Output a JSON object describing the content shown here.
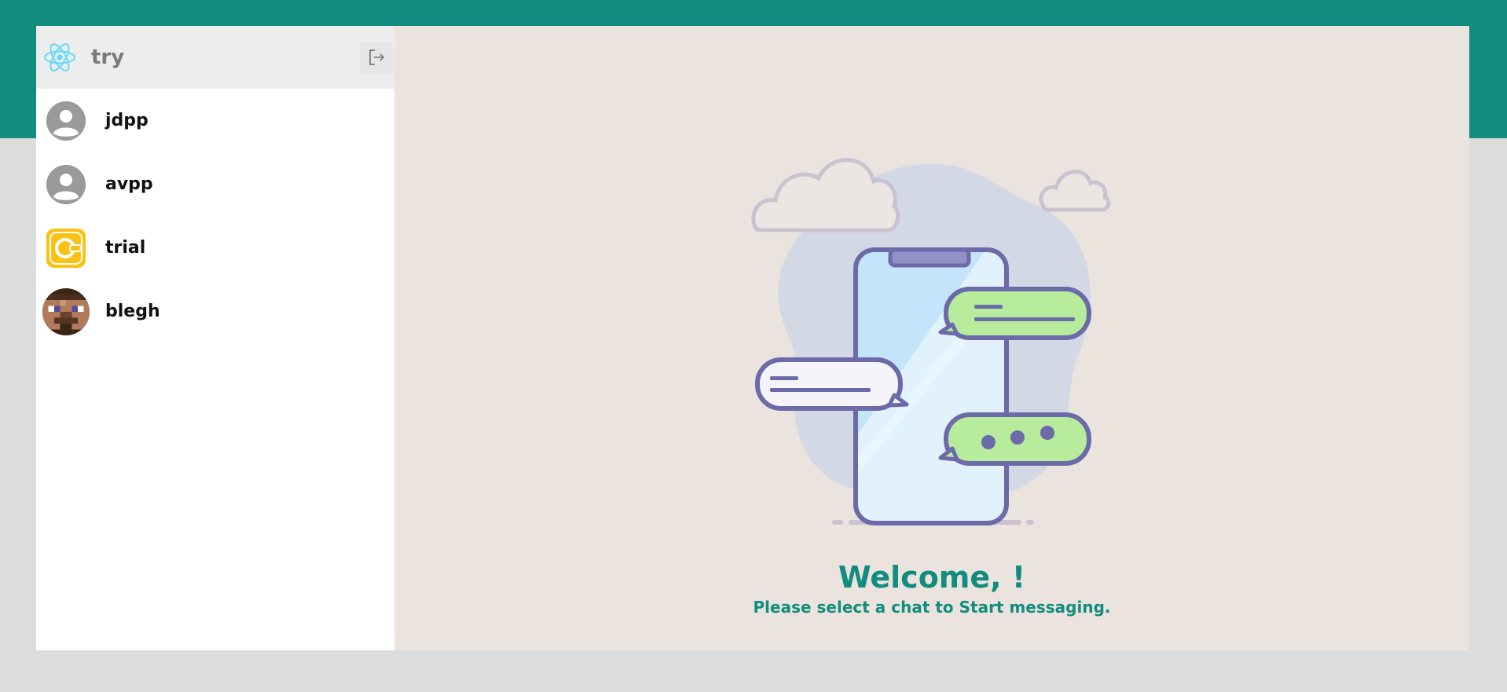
{
  "app": {
    "accent_color": "#128c7e",
    "header_band_color": "#128c7e",
    "background_color": "#dcdcdc",
    "chat_panel_bg": "#ebe4de"
  },
  "sidebar": {
    "logo_icon": "react-atom-icon",
    "current_user": "try",
    "logout_icon": "logout-icon",
    "chats": [
      {
        "name": "jdpp",
        "avatar": "default-user-icon"
      },
      {
        "name": "avpp",
        "avatar": "default-user-icon"
      },
      {
        "name": "trial",
        "avatar": "yellow-logo-icon"
      },
      {
        "name": "blegh",
        "avatar": "pixel-face-icon"
      }
    ]
  },
  "main": {
    "illustration": "phone-chat-bubbles-illustration",
    "welcome": "Welcome, !",
    "subtitle": "Please select a chat to Start messaging."
  }
}
